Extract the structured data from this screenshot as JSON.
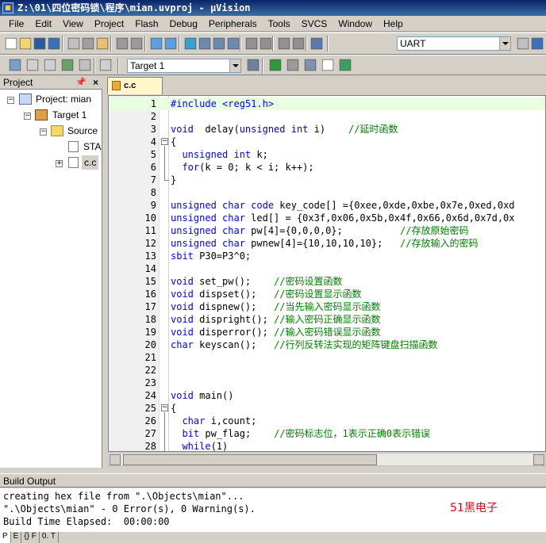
{
  "window": {
    "title": "Z:\\01\\四位密码锁\\程序\\mian.uvproj - µVision"
  },
  "menu": [
    "File",
    "Edit",
    "View",
    "Project",
    "Flash",
    "Debug",
    "Peripherals",
    "Tools",
    "SVCS",
    "Window",
    "Help"
  ],
  "toolbar": {
    "find_combo": "UART",
    "target_combo": "Target 1",
    "icons_row1": [
      "new-file-icon",
      "open-file-icon",
      "save-icon",
      "save-all-icon",
      "cut-icon",
      "copy-icon",
      "paste-icon",
      "undo-icon",
      "redo-icon",
      "back-icon",
      "forward-icon",
      "bookmark-icon",
      "prev-bookmark-icon",
      "next-bookmark-icon",
      "clear-bookmarks-icon",
      "indent-icon",
      "unindent-icon",
      "comment-icon",
      "uncomment-icon",
      "find-in-files-icon"
    ],
    "icons_row2": [
      "translate-icon",
      "build-icon",
      "rebuild-icon",
      "batch-build-icon",
      "stop-build-icon",
      "load-icon",
      "target-options-icon",
      "manage-components-icon",
      "file-extensions-icon",
      "select-packs-icon",
      "pack-installer-icon",
      "manage-runtime-icon"
    ]
  },
  "project_panel": {
    "title": "Project",
    "tree": {
      "project": "Project: mian",
      "target": "Target 1",
      "group": "Source",
      "files": [
        "STA",
        "c.c"
      ]
    },
    "tabs": [
      "P",
      "E",
      "{} F",
      "0. T"
    ]
  },
  "editor": {
    "tab_label": "c.c",
    "lines": [
      {
        "n": "1",
        "segs": [
          [
            "pp",
            "#include "
          ],
          [
            "pp",
            "<reg51.h>"
          ]
        ]
      },
      {
        "n": "2",
        "segs": []
      },
      {
        "n": "3",
        "segs": [
          [
            "kw",
            "void"
          ],
          [
            "",
            "  delay("
          ],
          [
            "kw",
            "unsigned"
          ],
          [
            "",
            " "
          ],
          [
            "kw",
            "int"
          ],
          [
            "",
            " i)    "
          ],
          [
            "cm",
            "//延时函数"
          ]
        ]
      },
      {
        "n": "4",
        "segs": [
          [
            "",
            "{"
          ]
        ]
      },
      {
        "n": "5",
        "segs": [
          [
            "",
            "  "
          ],
          [
            "kw",
            "unsigned"
          ],
          [
            "",
            " "
          ],
          [
            "kw",
            "int"
          ],
          [
            "",
            " k;"
          ]
        ]
      },
      {
        "n": "6",
        "segs": [
          [
            "",
            "  "
          ],
          [
            "kw",
            "for"
          ],
          [
            "",
            "(k = 0; k < i; k++);"
          ]
        ]
      },
      {
        "n": "7",
        "segs": [
          [
            "",
            "}"
          ]
        ]
      },
      {
        "n": "8",
        "segs": []
      },
      {
        "n": "9",
        "segs": [
          [
            "kw",
            "unsigned"
          ],
          [
            "",
            " "
          ],
          [
            "kw",
            "char"
          ],
          [
            "",
            " "
          ],
          [
            "kw",
            "code"
          ],
          [
            "",
            " key_code[] ={0xee,0xde,0xbe,0x7e,0xed,0xd"
          ]
        ]
      },
      {
        "n": "10",
        "segs": [
          [
            "kw",
            "unsigned"
          ],
          [
            "",
            " "
          ],
          [
            "kw",
            "char"
          ],
          [
            "",
            " led[] = {0x3f,0x06,0x5b,0x4f,0x66,0x6d,0x7d,0x"
          ]
        ]
      },
      {
        "n": "11",
        "segs": [
          [
            "kw",
            "unsigned"
          ],
          [
            "",
            " "
          ],
          [
            "kw",
            "char"
          ],
          [
            "",
            " pw[4]={0,0,0,0};          "
          ],
          [
            "cm",
            "//存放原始密码"
          ]
        ]
      },
      {
        "n": "12",
        "segs": [
          [
            "kw",
            "unsigned"
          ],
          [
            "",
            " "
          ],
          [
            "kw",
            "char"
          ],
          [
            "",
            " pwnew[4]={10,10,10,10};   "
          ],
          [
            "cm",
            "//存放输入的密码"
          ]
        ]
      },
      {
        "n": "13",
        "segs": [
          [
            "kw",
            "sbit"
          ],
          [
            "",
            " P30=P3^0;"
          ]
        ]
      },
      {
        "n": "14",
        "segs": []
      },
      {
        "n": "15",
        "segs": [
          [
            "kw",
            "void"
          ],
          [
            "",
            " set_pw();    "
          ],
          [
            "cm",
            "//密码设置函数"
          ]
        ]
      },
      {
        "n": "16",
        "segs": [
          [
            "kw",
            "void"
          ],
          [
            "",
            " dispset();   "
          ],
          [
            "cm",
            "//密码设置显示函数"
          ]
        ]
      },
      {
        "n": "17",
        "segs": [
          [
            "kw",
            "void"
          ],
          [
            "",
            " dispnew();   "
          ],
          [
            "cm",
            "//当先输入密码显示函数"
          ]
        ]
      },
      {
        "n": "18",
        "segs": [
          [
            "kw",
            "void"
          ],
          [
            "",
            " dispright(); "
          ],
          [
            "cm",
            "//输入密码正确显示函数"
          ]
        ]
      },
      {
        "n": "19",
        "segs": [
          [
            "kw",
            "void"
          ],
          [
            "",
            " disperror(); "
          ],
          [
            "cm",
            "//输入密码错误显示函数"
          ]
        ]
      },
      {
        "n": "20",
        "segs": [
          [
            "kw",
            "char"
          ],
          [
            "",
            " keyscan();   "
          ],
          [
            "cm",
            "//行列反转法实现的矩阵键盘扫描函数"
          ]
        ]
      },
      {
        "n": "21",
        "segs": []
      },
      {
        "n": "22",
        "segs": []
      },
      {
        "n": "23",
        "segs": []
      },
      {
        "n": "24",
        "segs": [
          [
            "kw",
            "void"
          ],
          [
            "",
            " main()"
          ]
        ]
      },
      {
        "n": "25",
        "segs": [
          [
            "",
            "{"
          ]
        ]
      },
      {
        "n": "26",
        "segs": [
          [
            "",
            "  "
          ],
          [
            "kw",
            "char"
          ],
          [
            "",
            " i,count;"
          ]
        ]
      },
      {
        "n": "27",
        "segs": [
          [
            "",
            "  "
          ],
          [
            "kw",
            "bit"
          ],
          [
            "",
            " pw_flag;    "
          ],
          [
            "cm",
            "//密码标志位，1表示正确0表示错误"
          ]
        ]
      },
      {
        "n": "28",
        "segs": [
          [
            "",
            "  "
          ],
          [
            "kw",
            "while"
          ],
          [
            "",
            "(1)"
          ]
        ]
      }
    ]
  },
  "build_output": {
    "title": "Build Output",
    "lines": [
      "creating hex file from \".\\Objects\\mian\"...",
      "\".\\Objects\\mian\" - 0 Error(s), 0 Warning(s).",
      "Build Time Elapsed:  00:00:00"
    ],
    "watermark": "51黑电子"
  }
}
